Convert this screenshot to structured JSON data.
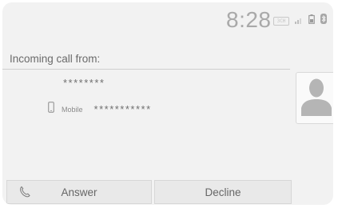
{
  "status_bar": {
    "time": "8:28",
    "badge_text": "3CH",
    "icons": [
      "signal-icon",
      "battery-icon",
      "bluetooth-icon"
    ]
  },
  "incoming_call": {
    "title": "Incoming call from:",
    "caller_name": "********",
    "caller_type": "Mobile",
    "caller_number": "***********",
    "icons": [
      "mobile-phone-icon",
      "contact-avatar-icon"
    ]
  },
  "actions": {
    "answer_label": "Answer",
    "decline_label": "Decline",
    "icons": [
      "phone-handset-icon"
    ]
  },
  "colors": {
    "background": "#f2f2f2",
    "text": "#6a6a6a",
    "button": "#e9e9e9",
    "avatar": "#b5b5b5"
  }
}
